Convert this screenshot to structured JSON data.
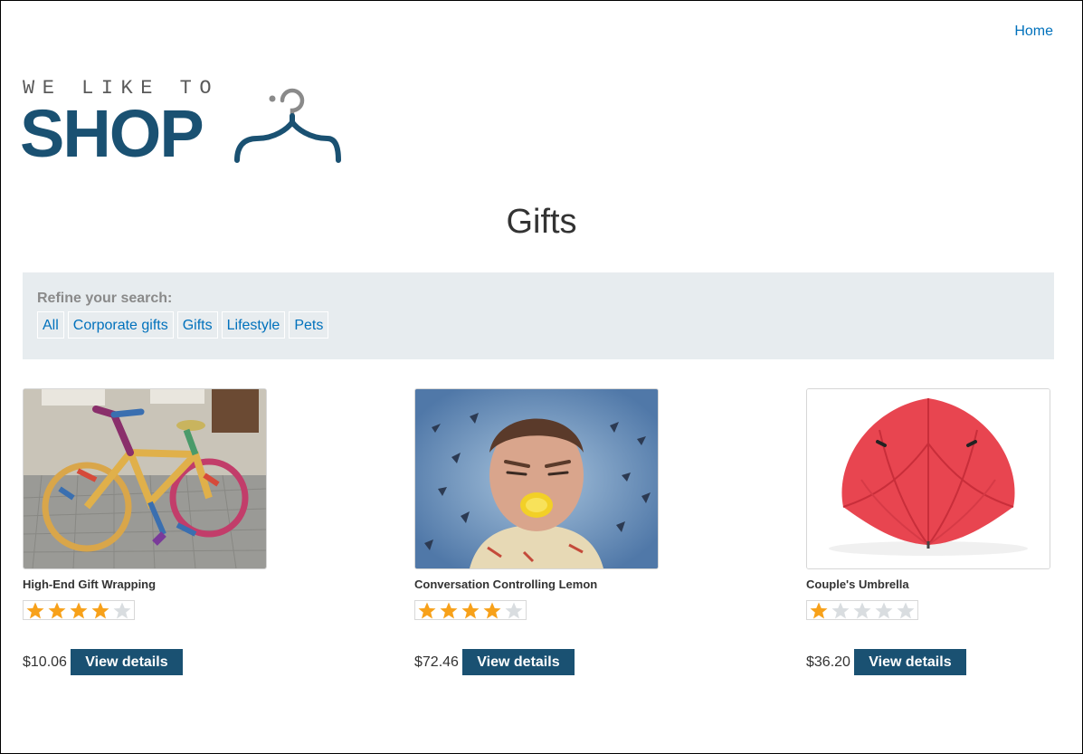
{
  "header": {
    "home_link": "Home",
    "logo": {
      "top_text": "WE LIKE TO",
      "main_text": "SHOP"
    }
  },
  "page": {
    "title": "Gifts"
  },
  "filters": {
    "heading": "Refine your search:",
    "items": [
      "All",
      "Corporate gifts",
      "Gifts",
      "Lifestyle",
      "Pets"
    ]
  },
  "products": [
    {
      "name": "High-End Gift Wrapping",
      "rating": 4,
      "price": "$10.06",
      "button": "View details",
      "image": "yarn-bombed-bicycle"
    },
    {
      "name": "Conversation Controlling Lemon",
      "rating": 4,
      "price": "$72.46",
      "button": "View details",
      "image": "man-with-lemon-in-mouth"
    },
    {
      "name": "Couple's Umbrella",
      "rating": 1,
      "price": "$36.20",
      "button": "View details",
      "image": "red-double-umbrella"
    }
  ],
  "colors": {
    "brand": "#1a5172",
    "link": "#0071bc",
    "star_filled": "#f7a11a",
    "star_empty": "#d9dde0",
    "filter_bg": "#e7ecef"
  }
}
